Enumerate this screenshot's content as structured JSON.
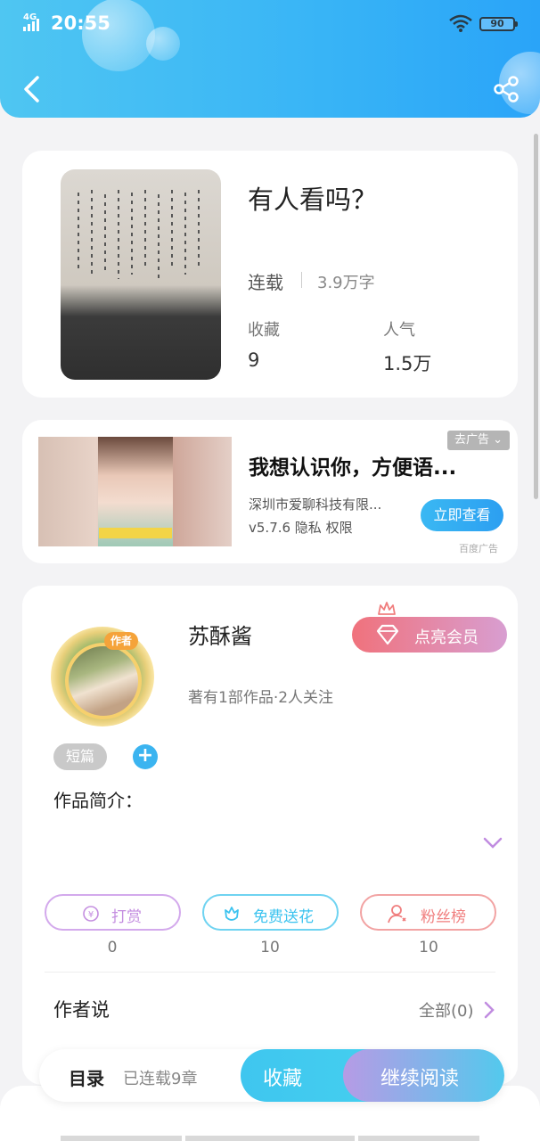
{
  "status_bar": {
    "network": "4G",
    "time": "20:55",
    "battery": "90"
  },
  "book": {
    "title": "有人看吗？",
    "status": "连载",
    "word_count": "3.9万字",
    "stats": [
      {
        "label": "收藏",
        "value": "9"
      },
      {
        "label": "人气",
        "value": "1.5万"
      }
    ]
  },
  "ad": {
    "title": "我想认识你，方便语...",
    "company": "深圳市爱聊科技有限...",
    "meta": "v5.7.6  隐私  权限",
    "cta": "立即查看",
    "close_label": "去广告 ⌄",
    "source": "百度广告"
  },
  "author": {
    "badge": "作者",
    "name": "苏酥酱",
    "meta": "著有1部作品·2人关注",
    "vip_button": "点亮会员",
    "tag": "短篇",
    "add_tag": "+",
    "intro_label": "作品简介："
  },
  "actions": [
    {
      "label": "打赏",
      "count": "0",
      "color": "#c48ee0"
    },
    {
      "label": "免费送花",
      "count": "10",
      "color": "#3cc3ef"
    },
    {
      "label": "粉丝榜",
      "count": "10",
      "color": "#f07e7e"
    }
  ],
  "author_says": {
    "title": "作者说",
    "see_all": "全部(0)"
  },
  "bottom_bar": {
    "toc": "目录",
    "chapters": "已连载9章",
    "favorite": "收藏",
    "continue_reading": "继续阅读"
  }
}
